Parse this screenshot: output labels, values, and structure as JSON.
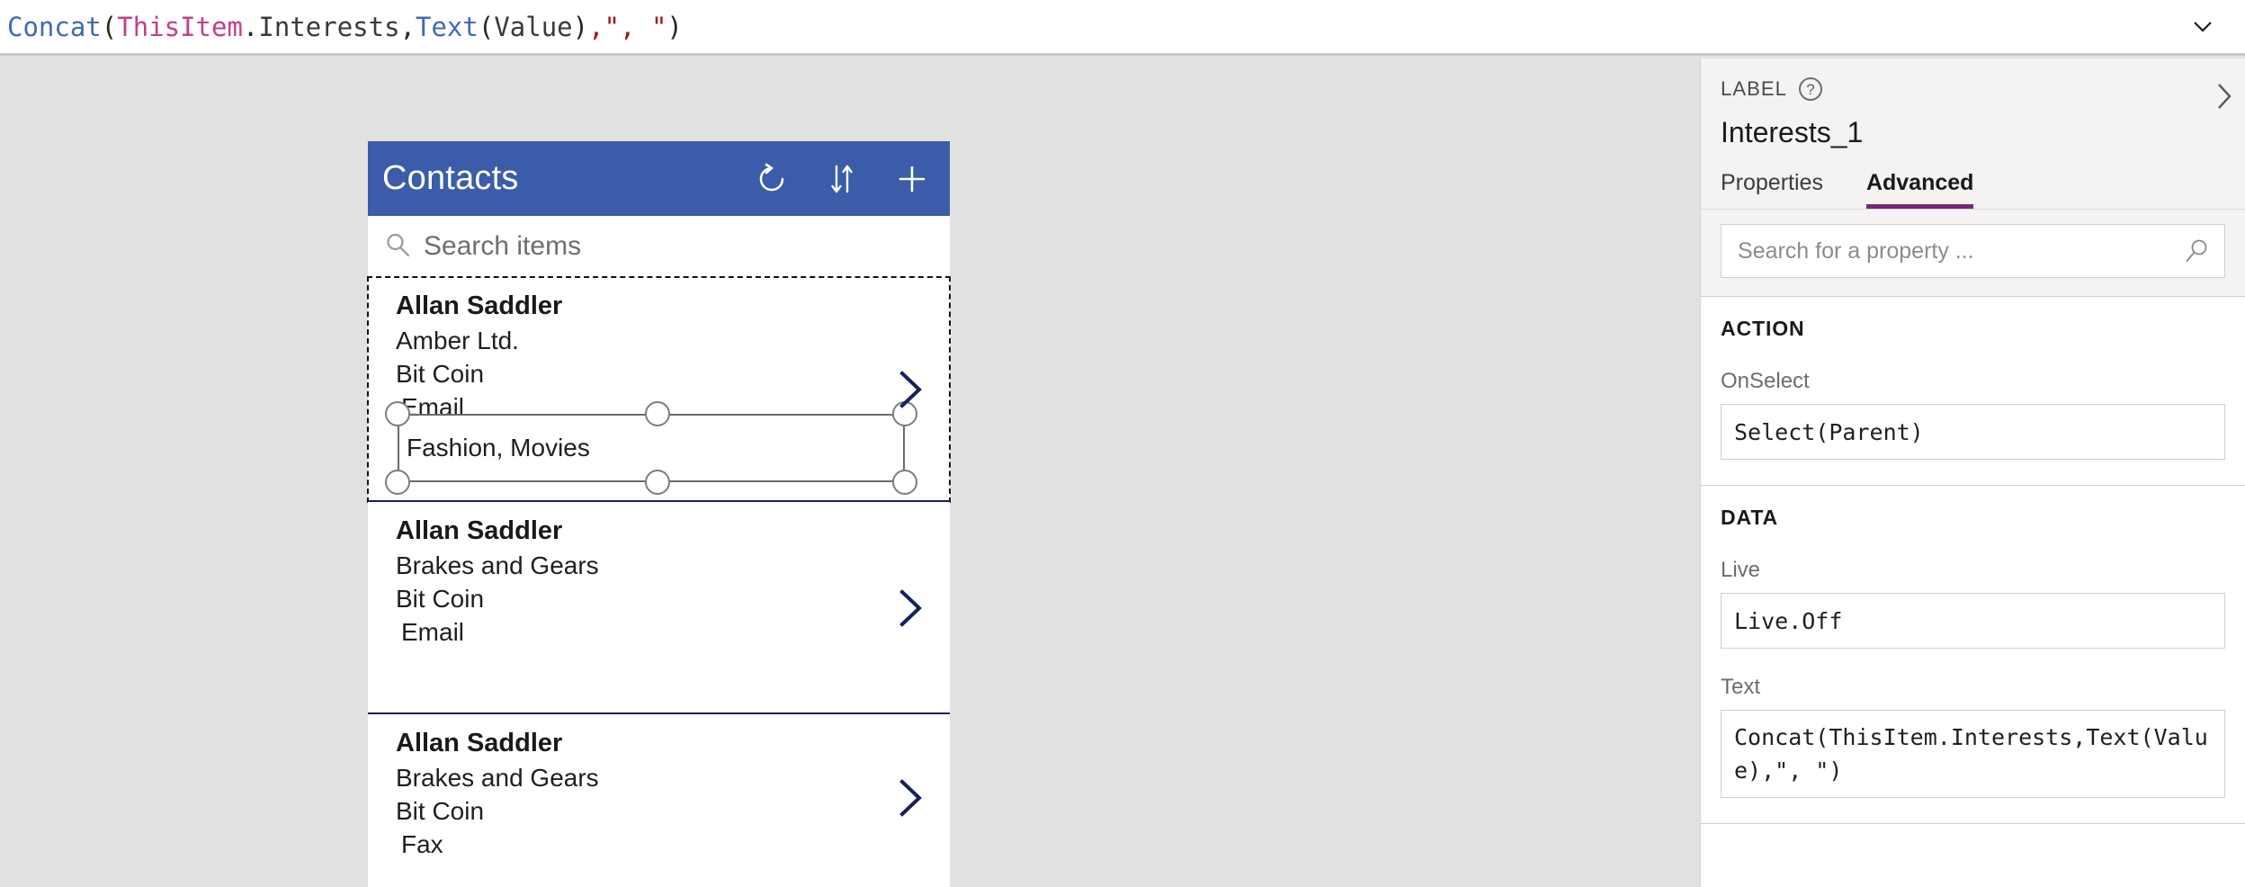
{
  "formula_bar": {
    "expression": "Concat(ThisItem.Interests,Text(Value),\", \")",
    "tokens": [
      {
        "t": "Concat",
        "c": "fn"
      },
      {
        "t": "(",
        "c": "paren"
      },
      {
        "t": "ThisItem",
        "c": "obj"
      },
      {
        "t": ".",
        "c": "punct"
      },
      {
        "t": "Interests",
        "c": "prop"
      },
      {
        "t": ",",
        "c": "punct"
      },
      {
        "t": "Text",
        "c": "fn"
      },
      {
        "t": "(",
        "c": "paren"
      },
      {
        "t": "Value",
        "c": "prop"
      },
      {
        "t": ")",
        "c": "paren"
      },
      {
        "t": ",",
        "c": "str"
      },
      {
        "t": "\", \"",
        "c": "str"
      },
      {
        "t": ")",
        "c": "paren"
      }
    ],
    "collapse_icon": "chevron-down-icon"
  },
  "app": {
    "header": {
      "title": "Contacts",
      "icons": [
        {
          "name": "refresh-icon"
        },
        {
          "name": "sort-icon"
        },
        {
          "name": "add-icon"
        }
      ]
    },
    "search": {
      "placeholder": "Search items",
      "icon": "search-icon"
    },
    "gallery": {
      "items": [
        {
          "name": "Allan Saddler",
          "company": "Amber Ltd.",
          "sub": "Bit Coin",
          "contact": "Email",
          "selected_label": "Fashion, Movies",
          "selected": true
        },
        {
          "name": "Allan Saddler",
          "company": "Brakes and Gears",
          "sub": "Bit Coin",
          "contact": "Email",
          "selected": false
        },
        {
          "name": "Allan Saddler",
          "company": "Brakes and Gears",
          "sub": "Bit Coin",
          "contact": "Fax",
          "selected": false
        }
      ]
    }
  },
  "panel": {
    "kind": "LABEL",
    "help_icon": "?",
    "expand_icon": "chevron-right-icon",
    "control_name": "Interests_1",
    "tabs": [
      {
        "label": "Properties",
        "active": false
      },
      {
        "label": "Advanced",
        "active": true
      }
    ],
    "search": {
      "placeholder": "Search for a property ...",
      "icon": "search-icon"
    },
    "sections": [
      {
        "title": "ACTION",
        "properties": [
          {
            "label": "OnSelect",
            "value": "Select(Parent)",
            "multiline": false
          }
        ]
      },
      {
        "title": "DATA",
        "properties": [
          {
            "label": "Live",
            "value": "Live.Off",
            "multiline": false
          },
          {
            "label": "Text",
            "value": "Concat(ThisItem.Interests,Text(Value),\", \")",
            "multiline": true
          }
        ]
      }
    ]
  },
  "colors": {
    "app_header_blue": "#3b5ca8",
    "accent_purple": "#742774",
    "chevron_navy": "#16215b",
    "workspace_gray": "#e1e1e1",
    "panel_header_gray": "#f4f3f2"
  }
}
